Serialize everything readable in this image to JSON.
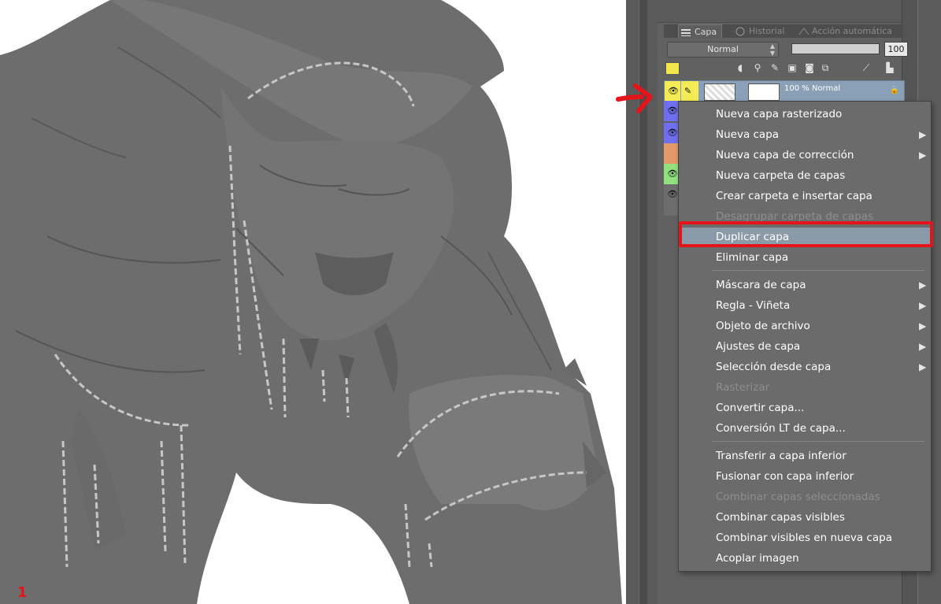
{
  "tabs": [
    {
      "label": "Capa",
      "active": true,
      "icon": "layers-icon"
    },
    {
      "label": "Historial",
      "active": false,
      "icon": "history-icon"
    },
    {
      "label": "Acción automática",
      "active": false,
      "icon": "auto-action-icon"
    }
  ],
  "blend_mode": "Normal",
  "opacity_value": "100",
  "selected_layer": {
    "opacity_text": "100 % Normal",
    "color": "#f5ec55"
  },
  "layer_colors": [
    "#f5ec55",
    "#6f6ff0",
    "#6f6ff0",
    "#e39a6b",
    "#92e07e",
    "#6d6d6d"
  ],
  "context_menu": {
    "items": [
      {
        "label": "Nueva capa rasterizado",
        "submenu": false,
        "disabled": false
      },
      {
        "label": "Nueva capa",
        "submenu": true,
        "disabled": false
      },
      {
        "label": "Nueva capa de corrección",
        "submenu": true,
        "disabled": false
      },
      {
        "label": "Nueva carpeta de capas",
        "submenu": false,
        "disabled": false
      },
      {
        "label": "Crear carpeta e insertar capa",
        "submenu": false,
        "disabled": false
      },
      {
        "label": "Desagrupar carpeta de capas",
        "submenu": false,
        "disabled": true
      },
      {
        "label": "Duplicar capa",
        "submenu": false,
        "disabled": false,
        "highlighted": true
      },
      {
        "label": "Eliminar capa",
        "submenu": false,
        "disabled": false
      },
      {
        "label": "Máscara de capa",
        "submenu": true,
        "disabled": false
      },
      {
        "label": "Regla - Viñeta",
        "submenu": true,
        "disabled": false
      },
      {
        "label": "Objeto de archivo",
        "submenu": true,
        "disabled": false
      },
      {
        "label": "Ajustes de capa",
        "submenu": true,
        "disabled": false
      },
      {
        "label": "Selección desde capa",
        "submenu": true,
        "disabled": false
      },
      {
        "label": "Rasterizar",
        "submenu": false,
        "disabled": true
      },
      {
        "label": "Convertir capa...",
        "submenu": false,
        "disabled": false
      },
      {
        "label": "Conversión LT de capa...",
        "submenu": false,
        "disabled": false
      },
      {
        "label": "Transferir a capa inferior",
        "submenu": false,
        "disabled": false
      },
      {
        "label": "Fusionar con capa inferior",
        "submenu": false,
        "disabled": false
      },
      {
        "label": "Combinar capas seleccionadas",
        "submenu": false,
        "disabled": true
      },
      {
        "label": "Combinar capas visibles",
        "submenu": false,
        "disabled": false
      },
      {
        "label": "Combinar visibles en nueva capa",
        "submenu": false,
        "disabled": false
      },
      {
        "label": "Acoplar imagen",
        "submenu": false,
        "disabled": false
      }
    ],
    "submenu_arrow": "▶"
  },
  "annotation_mark": "1",
  "colors": {
    "highlight_outline": "#e4141b",
    "menu_bg": "#6b6b6b",
    "menu_highlight": "#8b9aa8"
  }
}
